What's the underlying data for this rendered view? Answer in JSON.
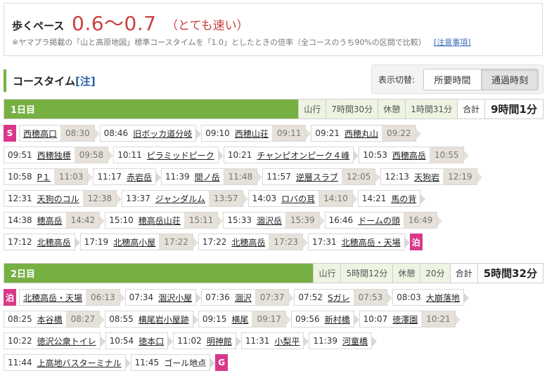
{
  "pace": {
    "label": "歩くペース",
    "value": "0.6〜0.7",
    "desc": "（とても速い）",
    "note": "※ヤマプラ掲載の「山と高原地図」標準コースタイムを「1.0」としたときの倍率（全コースのうち90%の区間で比較）",
    "note_link": "[注意事項]"
  },
  "coursetime": {
    "title": "コースタイム",
    "note": "[注]",
    "toggle_label": "表示切替:",
    "toggle_required": "所要時間",
    "toggle_passing": "通過時刻"
  },
  "days": [
    {
      "name": "1日目",
      "walk_label": "山行",
      "walk": "7時間30分",
      "rest_label": "休憩",
      "rest": "1時間31分",
      "total_label": "合計",
      "total": "9時間1分",
      "rows": [
        [
          {
            "badge": "S"
          },
          {
            "name": "西穂高口",
            "dep": "08:30"
          },
          {
            "time": "08:46",
            "name": "旧ボッカ道分岐"
          },
          {
            "time": "09:10",
            "name": "西穂山荘",
            "dep": "09:11"
          },
          {
            "time": "09:21",
            "name": "西穂丸山",
            "dep": "09:22"
          }
        ],
        [
          {
            "time": "09:51",
            "name": "西穂独標",
            "dep": "09:58"
          },
          {
            "time": "10:11",
            "name": "ピラミッドピーク"
          },
          {
            "time": "10:21",
            "name": "チャンピオンピーク４峰"
          },
          {
            "time": "10:53",
            "name": "西穂高岳",
            "dep": "10:55"
          }
        ],
        [
          {
            "time": "10:58",
            "name": "P１",
            "dep": "11:03"
          },
          {
            "time": "11:17",
            "name": "赤岩岳"
          },
          {
            "time": "11:39",
            "name": "間ノ岳",
            "dep": "11:48"
          },
          {
            "time": "11:57",
            "name": "逆層スラブ",
            "dep": "12:05"
          },
          {
            "time": "12:13",
            "name": "天狗岩",
            "dep": "12:19"
          }
        ],
        [
          {
            "time": "12:31",
            "name": "天狗のコル",
            "dep": "12:38"
          },
          {
            "time": "13:37",
            "name": "ジャンダルム",
            "dep": "13:57"
          },
          {
            "time": "14:03",
            "name": "ロバの耳",
            "dep": "14:10"
          },
          {
            "time": "14:21",
            "name": "馬の背"
          }
        ],
        [
          {
            "time": "14:38",
            "name": "穂高岳",
            "dep": "14:42"
          },
          {
            "time": "15:10",
            "name": "穂高岳山荘",
            "dep": "15:11"
          },
          {
            "time": "15:33",
            "name": "涸沢岳",
            "dep": "15:39"
          },
          {
            "time": "16:46",
            "name": "ドームの頭",
            "dep": "16:49"
          }
        ],
        [
          {
            "time": "17:12",
            "name": "北穂高岳"
          },
          {
            "time": "17:19",
            "name": "北穂高小屋",
            "dep": "17:22"
          },
          {
            "time": "17:22",
            "name": "北穂高岳",
            "dep": "17:23"
          },
          {
            "time": "17:31",
            "name": "北穂高岳・天場"
          },
          {
            "badge": "泊"
          }
        ]
      ]
    },
    {
      "name": "2日目",
      "walk_label": "山行",
      "walk": "5時間12分",
      "rest_label": "休憩",
      "rest": "20分",
      "total_label": "合計",
      "total": "5時間32分",
      "rows": [
        [
          {
            "badge": "泊"
          },
          {
            "name": "北穂高岳・天場",
            "dep": "06:13"
          },
          {
            "time": "07:34",
            "name": "涸沢小屋"
          },
          {
            "time": "07:36",
            "name": "涸沢",
            "dep": "07:37"
          },
          {
            "time": "07:52",
            "name": "Sガレ",
            "dep": "07:53"
          },
          {
            "time": "08:03",
            "name": "大崩落地"
          }
        ],
        [
          {
            "time": "08:25",
            "name": "本谷橋",
            "dep": "08:27"
          },
          {
            "time": "08:55",
            "name": "横尾岩小屋跡"
          },
          {
            "time": "09:15",
            "name": "横尾",
            "dep": "09:17"
          },
          {
            "time": "09:56",
            "name": "新村橋"
          },
          {
            "time": "10:07",
            "name": "徳澤園",
            "dep": "10:21"
          }
        ],
        [
          {
            "time": "10:22",
            "name": "徳沢公衆トイレ"
          },
          {
            "time": "10:54",
            "name": "徳本口"
          },
          {
            "time": "11:02",
            "name": "明神館"
          },
          {
            "time": "11:31",
            "name": "小梨平"
          },
          {
            "time": "11:39",
            "name": "河童橋"
          }
        ],
        [
          {
            "time": "11:44",
            "name": "上高地バスターミナル"
          },
          {
            "time": "11:45",
            "name": "ゴール地点",
            "plain": true
          },
          {
            "badge": "G"
          }
        ]
      ]
    }
  ],
  "colors": {
    "accent_green": "#76b043",
    "badge_pink": "#d9388a",
    "pace_red": "#c9413f",
    "dep_bg": "#e6e1d9"
  }
}
